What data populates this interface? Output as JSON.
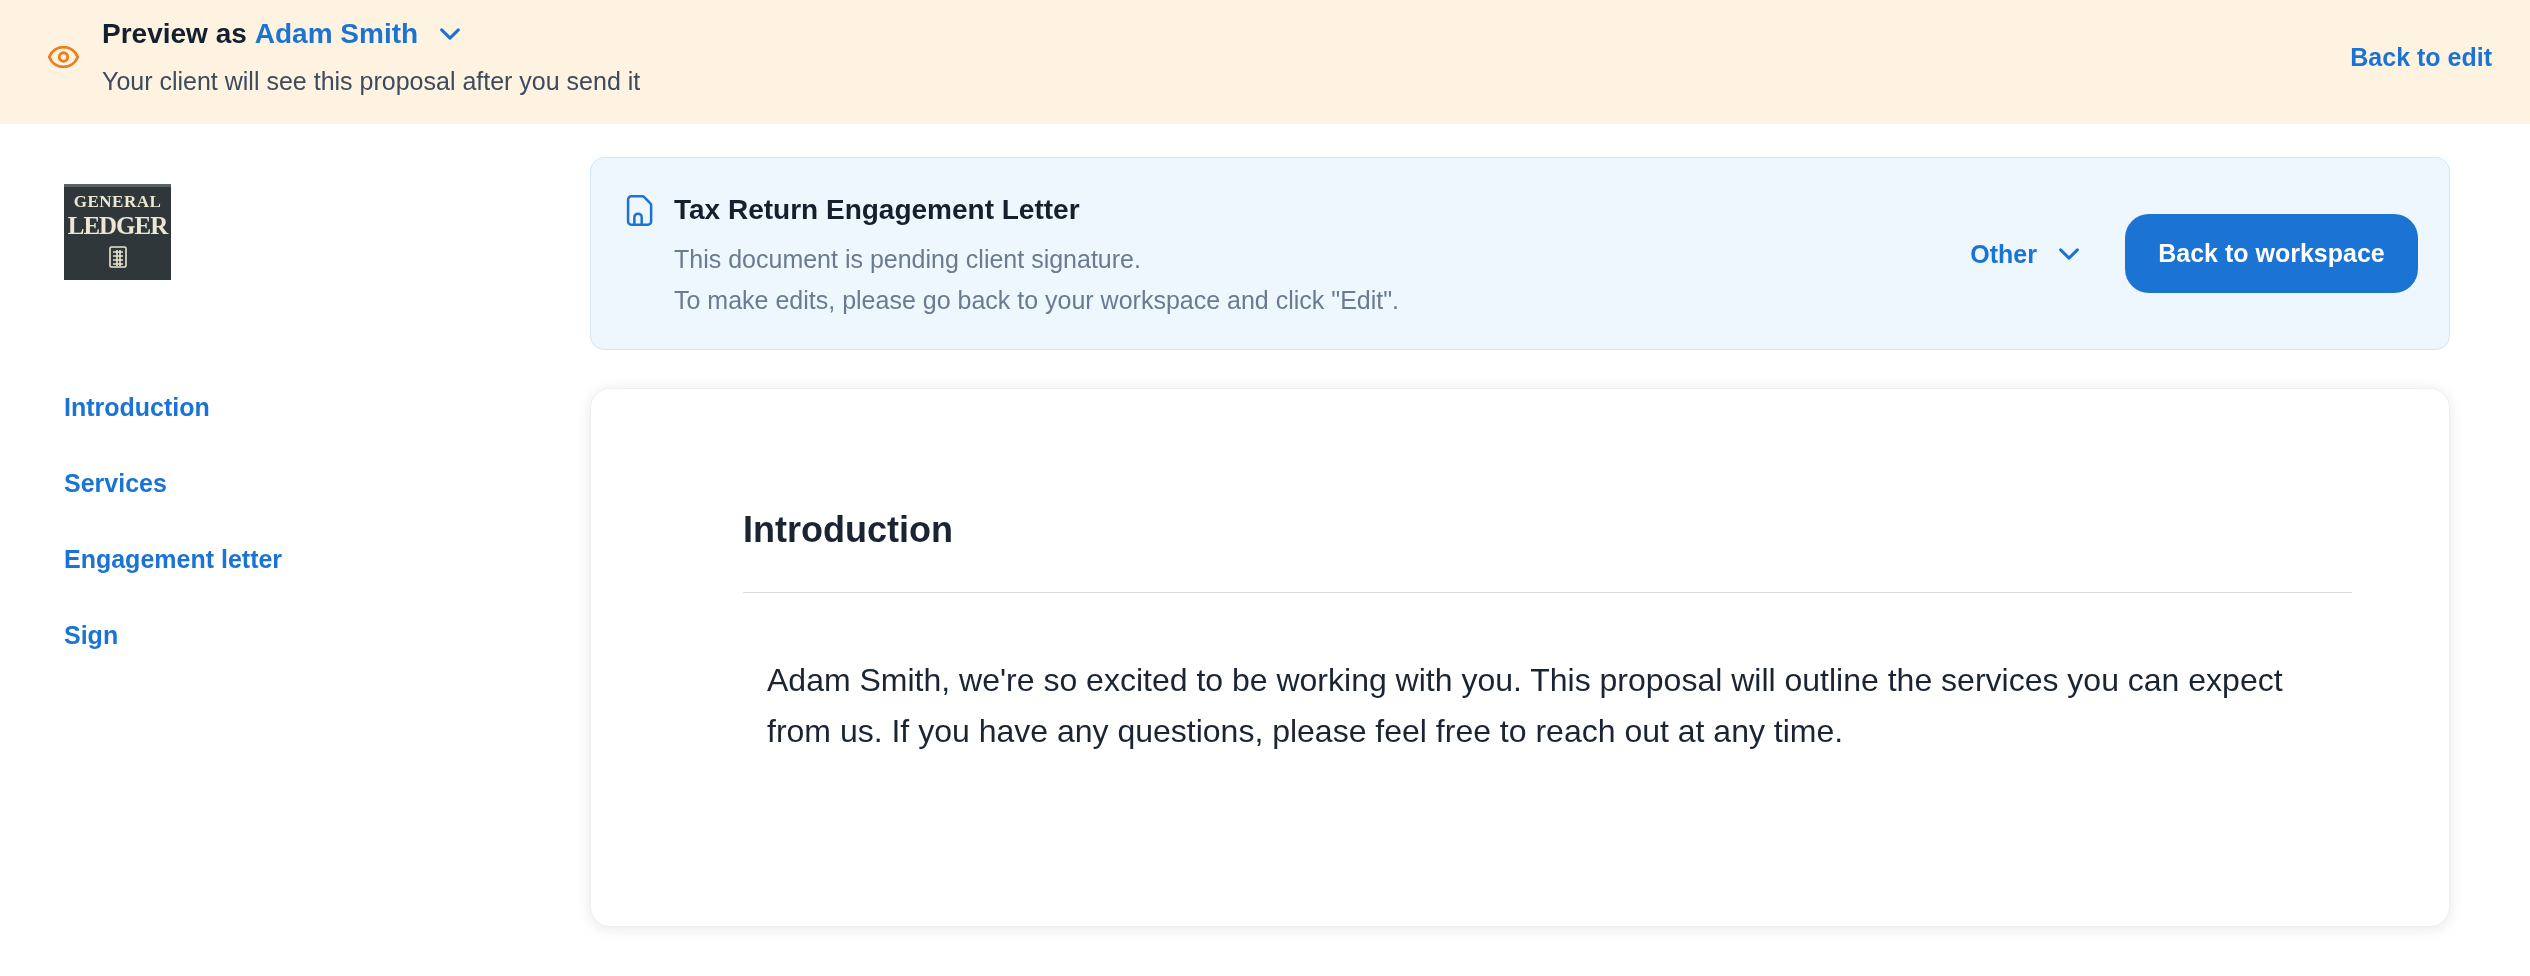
{
  "preview_banner": {
    "label": "Preview as",
    "client": "Adam Smith",
    "note": "Your client will see this proposal after you send it",
    "back_link": "Back to edit"
  },
  "sidebar": {
    "logo": {
      "lines": [
        "GENERAL",
        "LEDGER"
      ]
    },
    "nav": [
      {
        "label": "Introduction"
      },
      {
        "label": "Services"
      },
      {
        "label": "Engagement letter"
      },
      {
        "label": "Sign"
      }
    ]
  },
  "document": {
    "title": "Tax Return Engagement Letter",
    "notes": [
      "This document is pending client signature.",
      "To make edits, please go back to your workspace and click \"Edit\"."
    ],
    "status_menu": "Other",
    "primary_button": "Back to workspace"
  },
  "section": {
    "heading": "Introduction",
    "body": "Adam Smith, we're so excited to be working with you. This proposal will outline the services you can expect from us. If you have any questions, please feel free to reach out at any time."
  }
}
